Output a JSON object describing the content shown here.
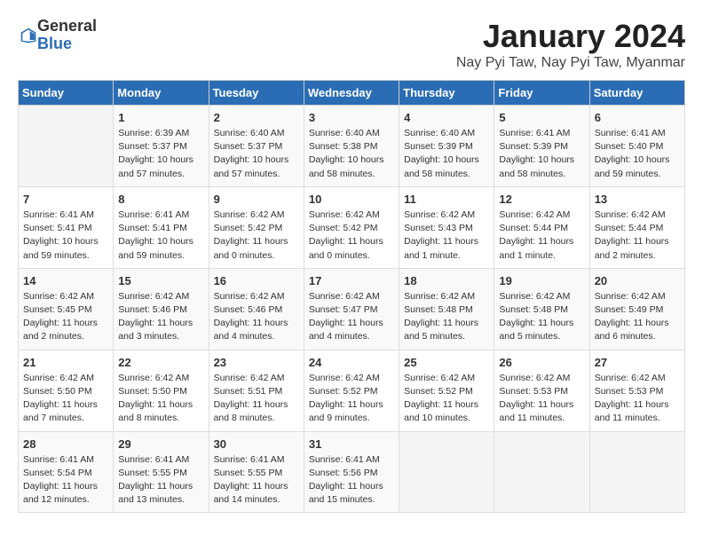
{
  "header": {
    "logo_line1": "General",
    "logo_line2": "Blue",
    "month": "January 2024",
    "location": "Nay Pyi Taw, Nay Pyi Taw, Myanmar"
  },
  "days_of_week": [
    "Sunday",
    "Monday",
    "Tuesday",
    "Wednesday",
    "Thursday",
    "Friday",
    "Saturday"
  ],
  "weeks": [
    [
      {
        "day": "",
        "info": ""
      },
      {
        "day": "1",
        "info": "Sunrise: 6:39 AM\nSunset: 5:37 PM\nDaylight: 10 hours\nand 57 minutes."
      },
      {
        "day": "2",
        "info": "Sunrise: 6:40 AM\nSunset: 5:37 PM\nDaylight: 10 hours\nand 57 minutes."
      },
      {
        "day": "3",
        "info": "Sunrise: 6:40 AM\nSunset: 5:38 PM\nDaylight: 10 hours\nand 58 minutes."
      },
      {
        "day": "4",
        "info": "Sunrise: 6:40 AM\nSunset: 5:39 PM\nDaylight: 10 hours\nand 58 minutes."
      },
      {
        "day": "5",
        "info": "Sunrise: 6:41 AM\nSunset: 5:39 PM\nDaylight: 10 hours\nand 58 minutes."
      },
      {
        "day": "6",
        "info": "Sunrise: 6:41 AM\nSunset: 5:40 PM\nDaylight: 10 hours\nand 59 minutes."
      }
    ],
    [
      {
        "day": "7",
        "info": "Sunrise: 6:41 AM\nSunset: 5:41 PM\nDaylight: 10 hours\nand 59 minutes."
      },
      {
        "day": "8",
        "info": "Sunrise: 6:41 AM\nSunset: 5:41 PM\nDaylight: 10 hours\nand 59 minutes."
      },
      {
        "day": "9",
        "info": "Sunrise: 6:42 AM\nSunset: 5:42 PM\nDaylight: 11 hours\nand 0 minutes."
      },
      {
        "day": "10",
        "info": "Sunrise: 6:42 AM\nSunset: 5:42 PM\nDaylight: 11 hours\nand 0 minutes."
      },
      {
        "day": "11",
        "info": "Sunrise: 6:42 AM\nSunset: 5:43 PM\nDaylight: 11 hours\nand 1 minute."
      },
      {
        "day": "12",
        "info": "Sunrise: 6:42 AM\nSunset: 5:44 PM\nDaylight: 11 hours\nand 1 minute."
      },
      {
        "day": "13",
        "info": "Sunrise: 6:42 AM\nSunset: 5:44 PM\nDaylight: 11 hours\nand 2 minutes."
      }
    ],
    [
      {
        "day": "14",
        "info": "Sunrise: 6:42 AM\nSunset: 5:45 PM\nDaylight: 11 hours\nand 2 minutes."
      },
      {
        "day": "15",
        "info": "Sunrise: 6:42 AM\nSunset: 5:46 PM\nDaylight: 11 hours\nand 3 minutes."
      },
      {
        "day": "16",
        "info": "Sunrise: 6:42 AM\nSunset: 5:46 PM\nDaylight: 11 hours\nand 4 minutes."
      },
      {
        "day": "17",
        "info": "Sunrise: 6:42 AM\nSunset: 5:47 PM\nDaylight: 11 hours\nand 4 minutes."
      },
      {
        "day": "18",
        "info": "Sunrise: 6:42 AM\nSunset: 5:48 PM\nDaylight: 11 hours\nand 5 minutes."
      },
      {
        "day": "19",
        "info": "Sunrise: 6:42 AM\nSunset: 5:48 PM\nDaylight: 11 hours\nand 5 minutes."
      },
      {
        "day": "20",
        "info": "Sunrise: 6:42 AM\nSunset: 5:49 PM\nDaylight: 11 hours\nand 6 minutes."
      }
    ],
    [
      {
        "day": "21",
        "info": "Sunrise: 6:42 AM\nSunset: 5:50 PM\nDaylight: 11 hours\nand 7 minutes."
      },
      {
        "day": "22",
        "info": "Sunrise: 6:42 AM\nSunset: 5:50 PM\nDaylight: 11 hours\nand 8 minutes."
      },
      {
        "day": "23",
        "info": "Sunrise: 6:42 AM\nSunset: 5:51 PM\nDaylight: 11 hours\nand 8 minutes."
      },
      {
        "day": "24",
        "info": "Sunrise: 6:42 AM\nSunset: 5:52 PM\nDaylight: 11 hours\nand 9 minutes."
      },
      {
        "day": "25",
        "info": "Sunrise: 6:42 AM\nSunset: 5:52 PM\nDaylight: 11 hours\nand 10 minutes."
      },
      {
        "day": "26",
        "info": "Sunrise: 6:42 AM\nSunset: 5:53 PM\nDaylight: 11 hours\nand 11 minutes."
      },
      {
        "day": "27",
        "info": "Sunrise: 6:42 AM\nSunset: 5:53 PM\nDaylight: 11 hours\nand 11 minutes."
      }
    ],
    [
      {
        "day": "28",
        "info": "Sunrise: 6:41 AM\nSunset: 5:54 PM\nDaylight: 11 hours\nand 12 minutes."
      },
      {
        "day": "29",
        "info": "Sunrise: 6:41 AM\nSunset: 5:55 PM\nDaylight: 11 hours\nand 13 minutes."
      },
      {
        "day": "30",
        "info": "Sunrise: 6:41 AM\nSunset: 5:55 PM\nDaylight: 11 hours\nand 14 minutes."
      },
      {
        "day": "31",
        "info": "Sunrise: 6:41 AM\nSunset: 5:56 PM\nDaylight: 11 hours\nand 15 minutes."
      },
      {
        "day": "",
        "info": ""
      },
      {
        "day": "",
        "info": ""
      },
      {
        "day": "",
        "info": ""
      }
    ]
  ]
}
